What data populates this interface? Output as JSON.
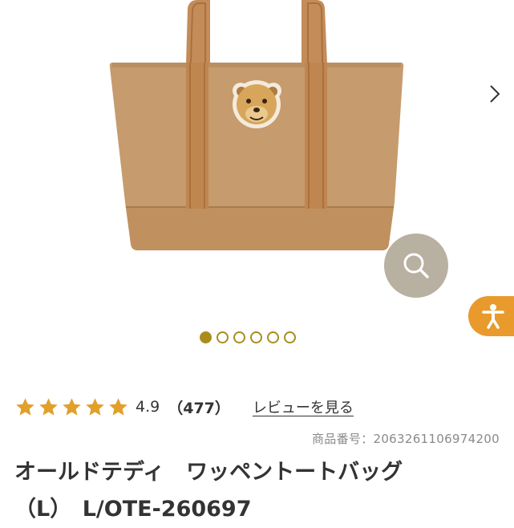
{
  "gallery": {
    "image_alt": "Old Teddy tote bag",
    "next_icon": "chevron-right-icon",
    "zoom_icon": "search-icon",
    "accessibility_icon": "accessibility-icon",
    "slide_count": 6,
    "active_slide": 1
  },
  "rating": {
    "stars": 5,
    "value": "4.9",
    "count": "（477）",
    "review_link": "レビューを見る"
  },
  "product": {
    "item_number": "商品番号：2063261106974200",
    "title_line1": "オールドテディ　ワッペントートバッグ",
    "title_line2": "（L）　L/OTE-260697"
  },
  "colors": {
    "accent": "#a88d1e",
    "star": "#e1a02b",
    "zoom_button": "#b8b0a1",
    "accessibility_button": "#e89a2c",
    "bag": "#c69b6d"
  }
}
